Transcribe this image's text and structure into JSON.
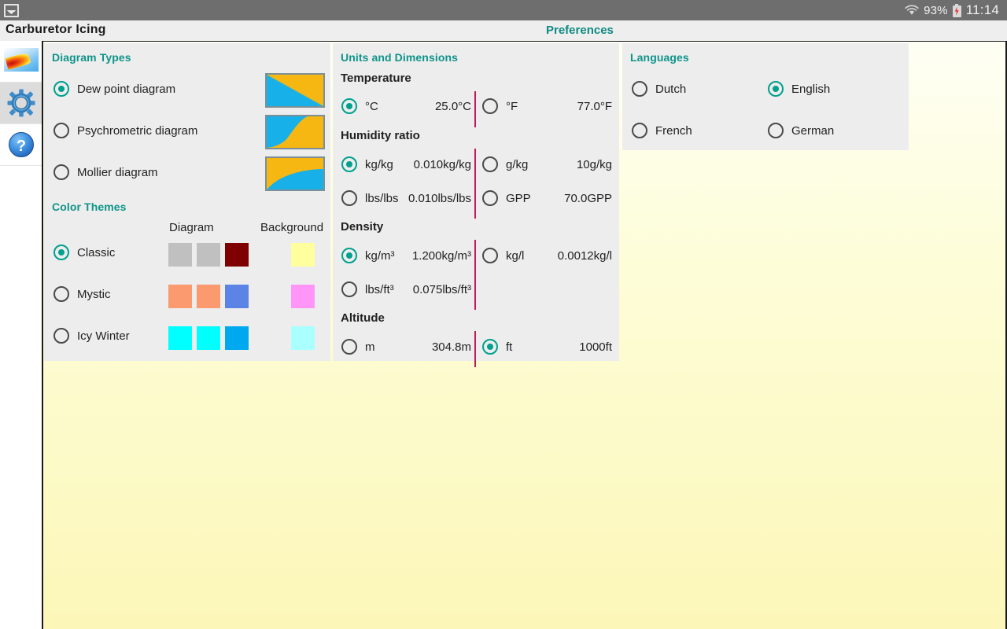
{
  "statusbar": {
    "app_icon": "image-icon",
    "wifi_icon": "wifi-icon",
    "battery_percent": "93%",
    "battery_icon": "battery-charging-icon",
    "clock": "11:14"
  },
  "titlebar": {
    "app_title": "Carburetor Icing",
    "screen_title": "Preferences"
  },
  "rail": {
    "items": [
      {
        "name": "diagram-icon",
        "label": "Diagram",
        "active": false
      },
      {
        "name": "settings-gear-icon",
        "label": "Preferences",
        "active": true
      },
      {
        "name": "help-question-icon",
        "label": "Help",
        "active": false
      }
    ]
  },
  "diagram_types": {
    "title": "Diagram Types",
    "options": [
      {
        "label": "Dew point diagram",
        "selected": true
      },
      {
        "label": "Psychrometric diagram",
        "selected": false
      },
      {
        "label": "Mollier diagram",
        "selected": false
      }
    ]
  },
  "color_themes": {
    "title": "Color Themes",
    "col_diagram": "Diagram",
    "col_background": "Background",
    "options": [
      {
        "label": "Classic",
        "selected": true,
        "diagram_colors": [
          "#c0c0c0",
          "#c0c0c0",
          "#7e0000"
        ],
        "background_color": "#ffff9e"
      },
      {
        "label": "Mystic",
        "selected": false,
        "diagram_colors": [
          "#fa9a6e",
          "#fa9a6e",
          "#5b84e6"
        ],
        "background_color": "#ff96f7"
      },
      {
        "label": "Icy Winter",
        "selected": false,
        "diagram_colors": [
          "#00ffff",
          "#00ffff",
          "#00a9ef"
        ],
        "background_color": "#aaffff"
      }
    ]
  },
  "units": {
    "title": "Units and Dimensions",
    "groups": [
      {
        "name": "Temperature",
        "rows": [
          [
            {
              "unit": "°C",
              "value": "25.0°C",
              "selected": true
            },
            {
              "unit": "°F",
              "value": "77.0°F",
              "selected": false
            }
          ]
        ]
      },
      {
        "name": "Humidity ratio",
        "rows": [
          [
            {
              "unit": "kg/kg",
              "value": "0.010kg/kg",
              "selected": true
            },
            {
              "unit": "g/kg",
              "value": "10g/kg",
              "selected": false
            }
          ],
          [
            {
              "unit": "lbs/lbs",
              "value": "0.010lbs/lbs",
              "selected": false
            },
            {
              "unit": "GPP",
              "value": "70.0GPP",
              "selected": false
            }
          ]
        ]
      },
      {
        "name": "Density",
        "rows": [
          [
            {
              "unit": "kg/m³",
              "value": "1.200kg/m³",
              "selected": true
            },
            {
              "unit": "kg/l",
              "value": "0.0012kg/l",
              "selected": false
            }
          ],
          [
            {
              "unit": "lbs/ft³",
              "value": "0.075lbs/ft³",
              "selected": false
            }
          ]
        ]
      },
      {
        "name": "Altitude",
        "rows": [
          [
            {
              "unit": "m",
              "value": "304.8m",
              "selected": false
            },
            {
              "unit": "ft",
              "value": "1000ft",
              "selected": true
            }
          ]
        ]
      }
    ],
    "divider_color": "#c2185b"
  },
  "languages": {
    "title": "Languages",
    "options": [
      {
        "label": "Dutch",
        "selected": false
      },
      {
        "label": "English",
        "selected": true
      },
      {
        "label": "French",
        "selected": false
      },
      {
        "label": "German",
        "selected": false
      }
    ]
  },
  "colors": {
    "accent_teal": "#0e9489",
    "panel_bg": "#ededed",
    "canvas_top": "#fefff4",
    "canvas_bottom": "#fcf7b8",
    "statusbar_bg": "#6e6e6e"
  }
}
